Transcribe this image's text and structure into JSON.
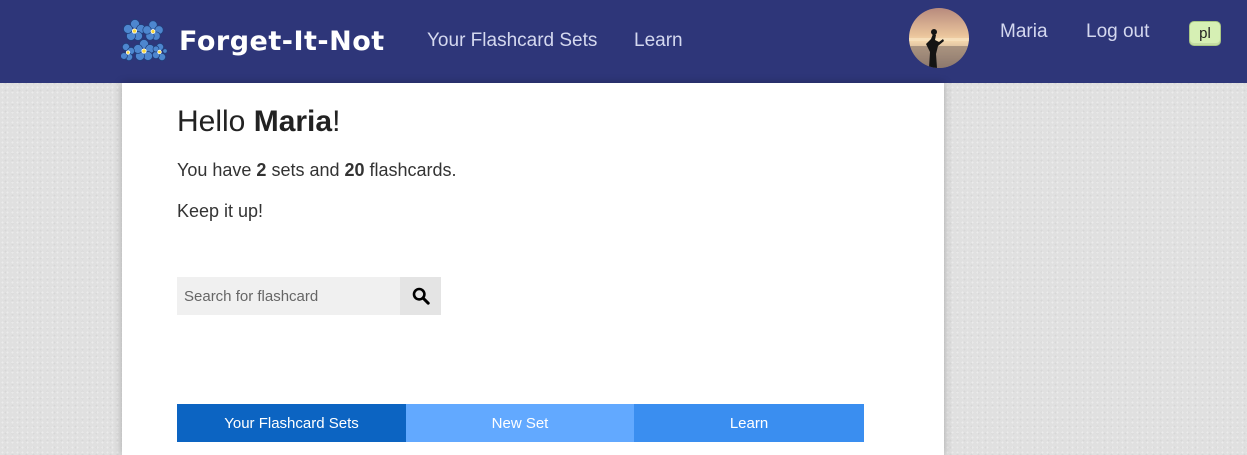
{
  "navbar": {
    "brand_name": "Forget-It-Not",
    "links": {
      "sets": "Your Flashcard Sets",
      "learn": "Learn"
    },
    "user_name": "Maria",
    "logout": "Log out",
    "language": "pl",
    "background": "#2e3679"
  },
  "main": {
    "greeting_prefix": "Hello ",
    "greeting_name": "Maria",
    "greeting_suffix": "!",
    "stats": {
      "prefix": "You have ",
      "sets_count": "2",
      "middle": " sets and ",
      "cards_count": "20",
      "suffix": " flashcards."
    },
    "encouragement": "Keep it up!",
    "search": {
      "placeholder": "Search for flashcard",
      "value": ""
    },
    "tabs": [
      {
        "label": "Your Flashcard Sets",
        "color": "#0c64c2"
      },
      {
        "label": "New Set",
        "color": "#62a9ff"
      },
      {
        "label": "Learn",
        "color": "#3a8ef0"
      }
    ]
  },
  "icons": [
    "forget-me-not-flower-icon",
    "search-icon"
  ]
}
